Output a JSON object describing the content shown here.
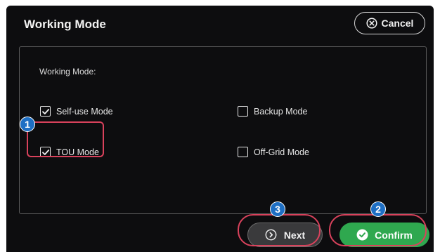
{
  "dialog": {
    "title": "Working Mode",
    "cancel_label": "Cancel",
    "cancel_icon": "circle-x-icon"
  },
  "panel": {
    "section_label": "Working Mode:",
    "options": [
      {
        "label": "Self-use Mode",
        "checked": true
      },
      {
        "label": "Backup Mode",
        "checked": false
      },
      {
        "label": "TOU Mode",
        "checked": true
      },
      {
        "label": "Off-Grid Mode",
        "checked": false
      }
    ]
  },
  "footer": {
    "next_label": "Next",
    "next_icon": "circle-arrow-right-icon",
    "confirm_label": "Confirm",
    "confirm_icon": "circle-check-icon"
  },
  "annotations": {
    "step1": "1",
    "step2": "2",
    "step3": "3",
    "highlight_color": "#d9425c",
    "badge_color": "#1e6fc4"
  },
  "colors": {
    "background": "#0d0d0f",
    "confirm": "#2fa84f",
    "next": "#3a3a3c"
  }
}
